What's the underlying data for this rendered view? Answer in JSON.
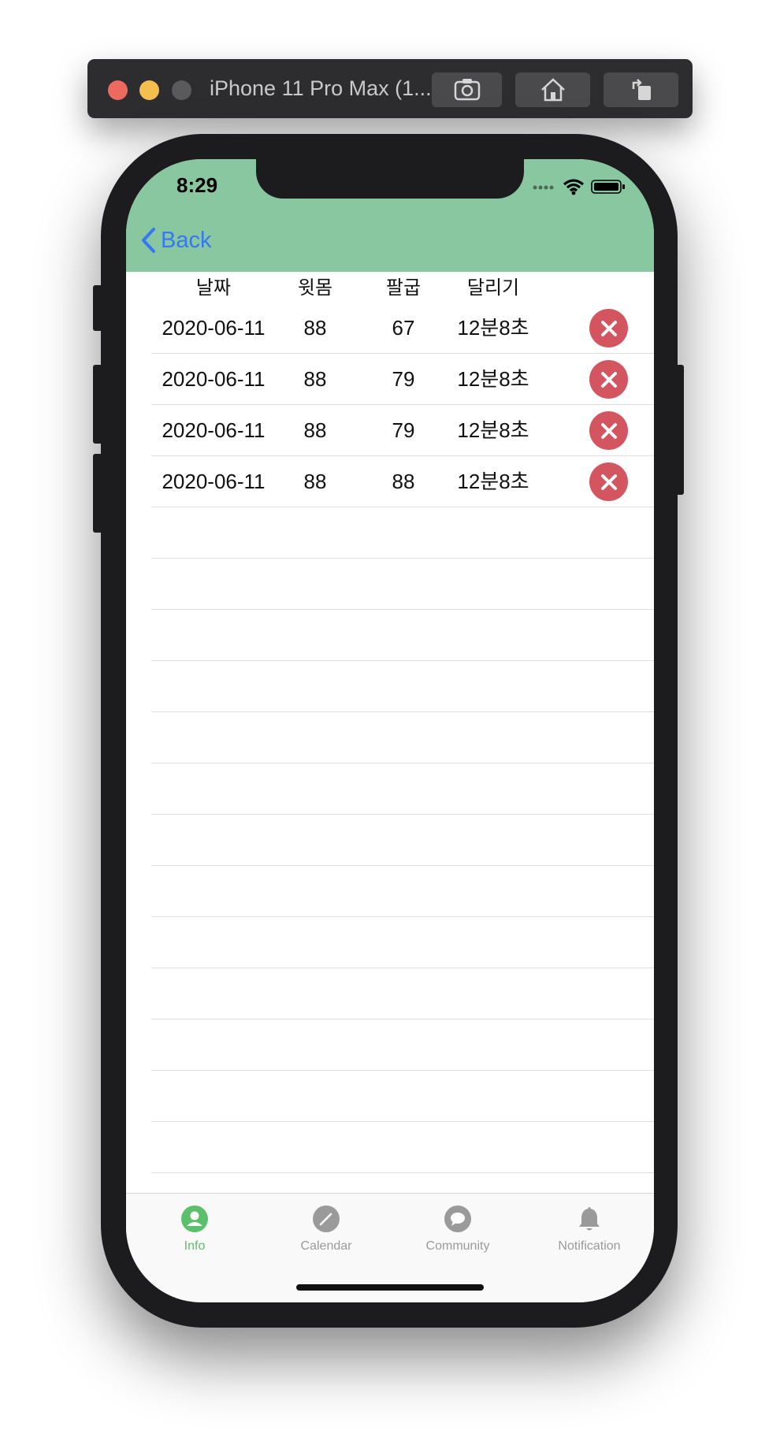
{
  "simulator": {
    "title": "iPhone 11 Pro Max (1...",
    "buttons": [
      "screenshot-icon",
      "home-icon",
      "rotate-icon"
    ]
  },
  "status_bar": {
    "time": "8:29"
  },
  "nav": {
    "back_label": "Back",
    "header_color": "#88c7a0",
    "accent": "#3478f6"
  },
  "table": {
    "headers": [
      "날짜",
      "윗몸",
      "팔굽",
      "달리기"
    ],
    "rows": [
      {
        "date": "2020-06-11",
        "situps": "88",
        "pushups": "67",
        "run": "12분8초"
      },
      {
        "date": "2020-06-11",
        "situps": "88",
        "pushups": "79",
        "run": "12분8초"
      },
      {
        "date": "2020-06-11",
        "situps": "88",
        "pushups": "79",
        "run": "12분8초"
      },
      {
        "date": "2020-06-11",
        "situps": "88",
        "pushups": "88",
        "run": "12분8초"
      }
    ],
    "delete_color": "#d35560"
  },
  "tabbar": {
    "items": [
      {
        "label": "Info",
        "icon": "person-icon",
        "active": true
      },
      {
        "label": "Calendar",
        "icon": "pencil-icon",
        "active": false
      },
      {
        "label": "Community",
        "icon": "chat-bubble-icon",
        "active": false
      },
      {
        "label": "Notification",
        "icon": "bell-icon",
        "active": false
      }
    ],
    "active_color": "#5cbf6c",
    "inactive_color": "#9a9a9a"
  }
}
